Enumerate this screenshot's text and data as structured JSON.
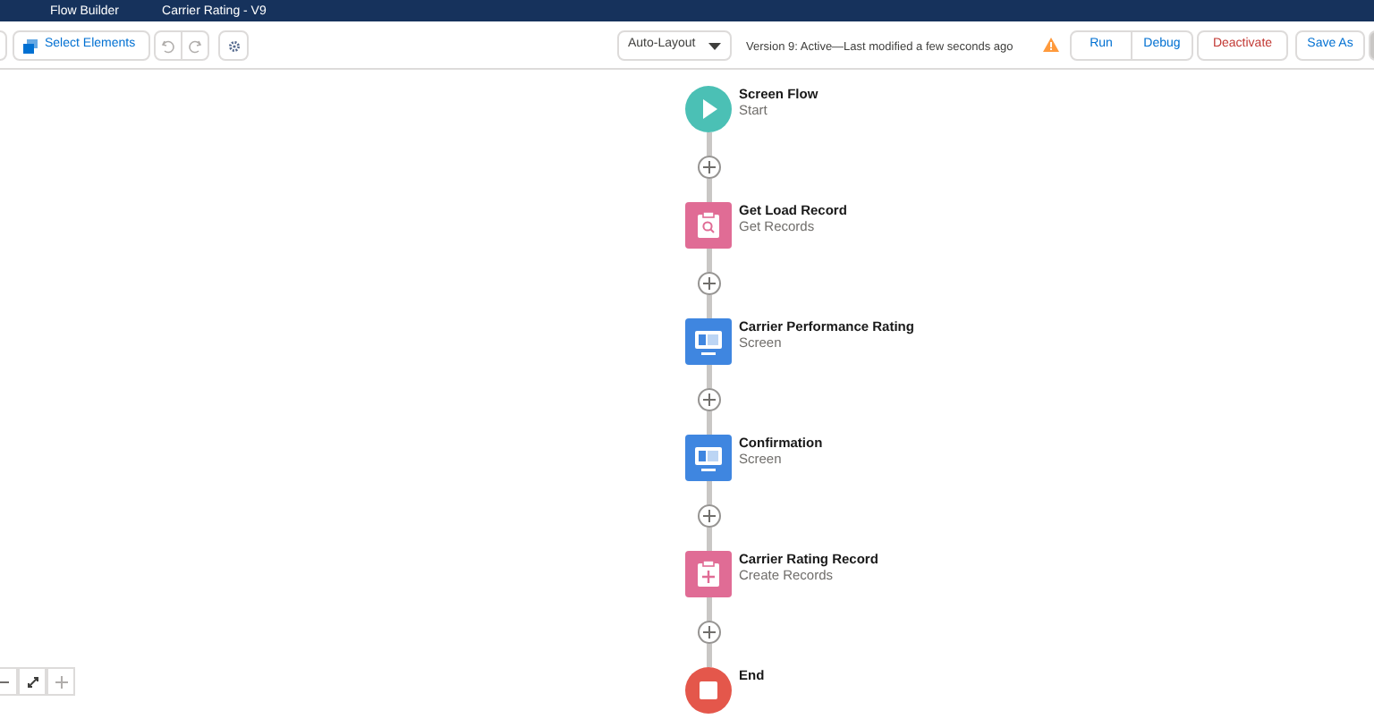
{
  "header": {
    "app_title": "Flow Builder",
    "flow_title": "Carrier Rating - V9"
  },
  "toolbar": {
    "select_elements": "Select Elements",
    "layout_menu": "Auto-Layout",
    "version_status": "Version 9: Active—Last modified a few seconds ago",
    "buttons": [
      {
        "label": "Run",
        "kind": "brand"
      },
      {
        "label": "Debug",
        "kind": "brand"
      },
      {
        "label": "Deactivate",
        "kind": "destructive"
      },
      {
        "label": "Save As",
        "kind": "brand"
      }
    ]
  },
  "flow": {
    "nodes": [
      {
        "kind": "start",
        "title": "Screen Flow",
        "subtitle": "Start"
      },
      {
        "kind": "get_records",
        "title": "Get Load Record",
        "subtitle": "Get Records"
      },
      {
        "kind": "screen",
        "title": "Carrier Performance Rating",
        "subtitle": "Screen"
      },
      {
        "kind": "screen",
        "title": "Confirmation",
        "subtitle": "Screen"
      },
      {
        "kind": "create_records",
        "title": "Carrier Rating Record",
        "subtitle": "Create Records"
      },
      {
        "kind": "end",
        "title": "End"
      }
    ]
  }
}
